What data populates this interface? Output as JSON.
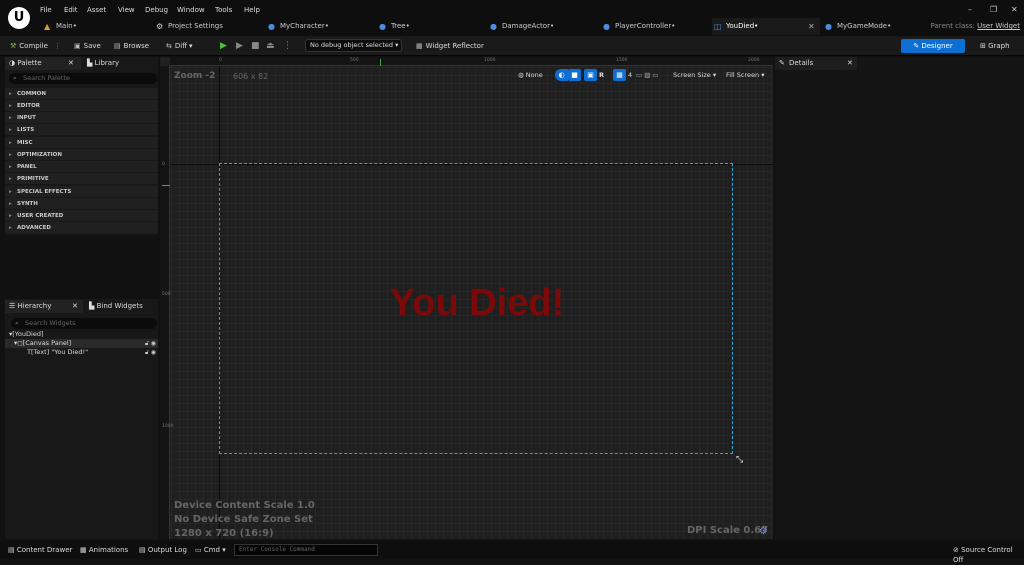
{
  "menu": [
    "File",
    "Edit",
    "Asset",
    "View",
    "Debug",
    "Window",
    "Tools",
    "Help"
  ],
  "window_controls": {
    "minimize": "–",
    "restore": "❐",
    "close": "✕"
  },
  "tabs": [
    {
      "label": "Main•",
      "icon": "level-icon"
    },
    {
      "label": "Project Settings",
      "icon": "gear-icon"
    },
    {
      "label": "MyCharacter•",
      "icon": "character-icon"
    },
    {
      "label": "Tree•",
      "icon": "actor-icon"
    },
    {
      "label": "DamageActor•",
      "icon": "actor-icon"
    },
    {
      "label": "PlayerController•",
      "icon": "actor-icon"
    },
    {
      "label": "YouDied•",
      "icon": "widget-icon"
    },
    {
      "label": "MyGameMode•",
      "icon": "actor-icon"
    }
  ],
  "parent_class": {
    "label": "Parent class:",
    "value": "User Widget"
  },
  "toolbar": {
    "compile": "Compile",
    "save": "Save",
    "browse": "Browse",
    "diff": "Diff",
    "debug_object": "No debug object selected",
    "widget_reflector": "Widget Reflector",
    "designer": "Designer",
    "graph": "Graph"
  },
  "palette": {
    "tab": "Palette",
    "library_tab": "Library",
    "search_placeholder": "Search Palette",
    "categories": [
      "COMMON",
      "EDITOR",
      "INPUT",
      "LISTS",
      "MISC",
      "OPTIMIZATION",
      "PANEL",
      "PRIMITIVE",
      "SPECIAL EFFECTS",
      "SYNTH",
      "USER CREATED",
      "ADVANCED"
    ]
  },
  "hierarchy": {
    "tab": "Hierarchy",
    "bind_tab": "Bind Widgets",
    "search_placeholder": "Search Widgets",
    "items": [
      "[YouDied]",
      "[Canvas Panel]",
      "[Text] \"You Died!\""
    ]
  },
  "viewport": {
    "zoom": "Zoom -2",
    "size": "606 x 82",
    "none": "None",
    "r": "R",
    "grid_num": "4",
    "screen_size": "Screen Size",
    "fill_screen": "Fill Screen",
    "ruler_top": [
      "0",
      "500",
      "1000",
      "1500",
      "2000"
    ],
    "ruler_left": [
      "0",
      "500",
      "1000"
    ],
    "canvas_text": "You Died!",
    "device_scale": "Device Content Scale 1.0",
    "safe_zone": "No Device Safe Zone Set",
    "resolution": "1280 x 720 (16:9)",
    "dpi": "DPI Scale 0.67"
  },
  "details": {
    "tab": "Details"
  },
  "bottom": {
    "content_drawer": "Content Drawer",
    "animations": "Animations",
    "output_log": "Output Log",
    "cmd": "Cmd",
    "console_placeholder": "Enter Console Command",
    "source_control": "Source Control Off"
  }
}
